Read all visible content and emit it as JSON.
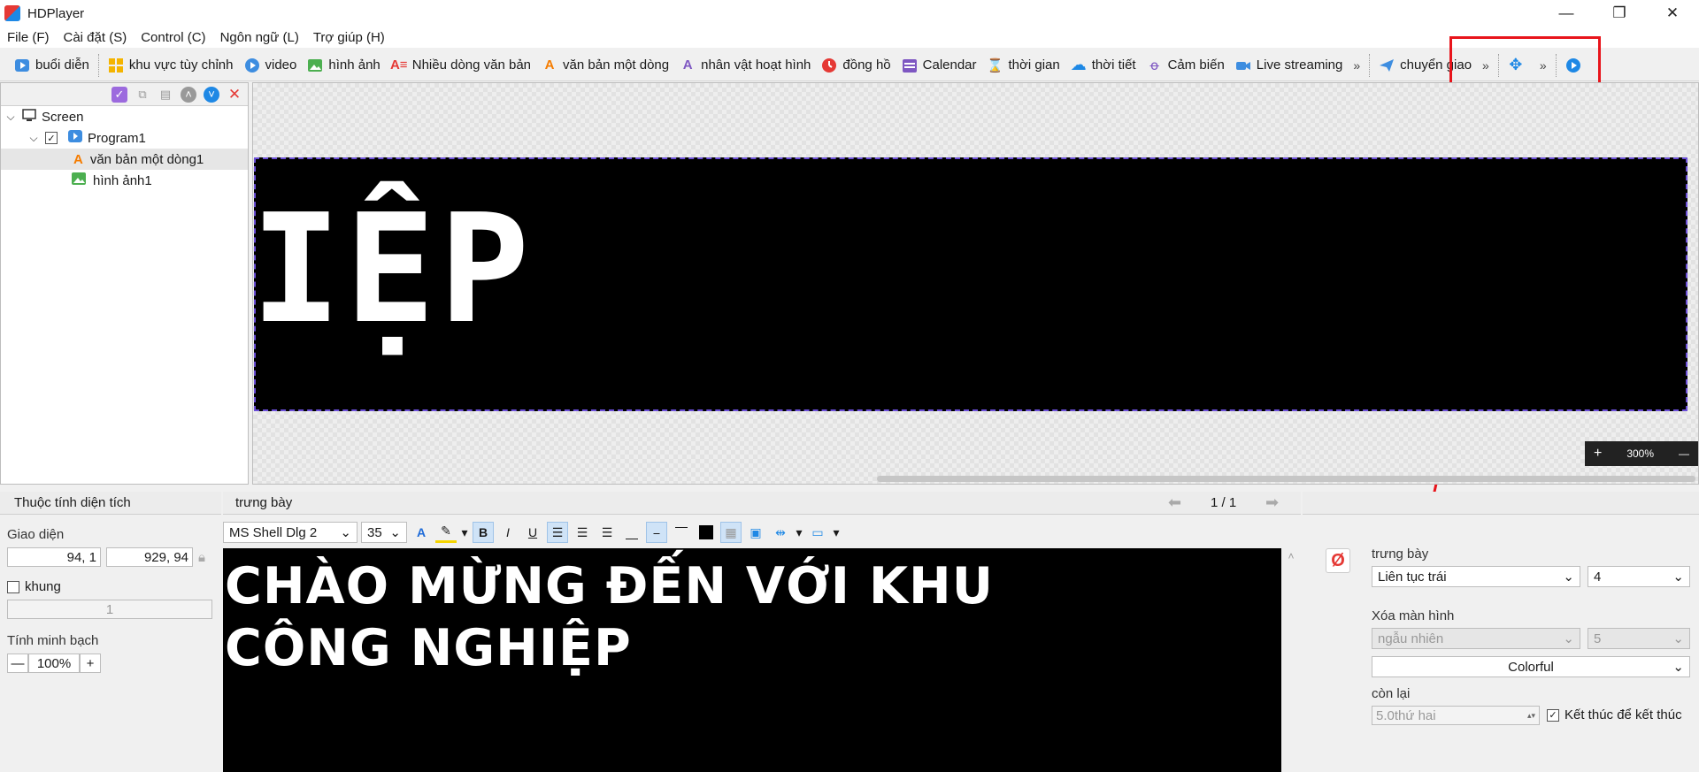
{
  "window": {
    "title": "HDPlayer",
    "controls": [
      "—",
      "❐",
      "✕"
    ]
  },
  "menu": [
    "File (F)",
    "Cài đặt (S)",
    "Control (C)",
    "Ngôn ngữ (L)",
    "Trợ giúp (H)"
  ],
  "toolbar": {
    "program": "buổi diễn",
    "custom_area": "khu vực tùy chỉnh",
    "video": "video",
    "image": "hình ảnh",
    "multiline_text": "Nhiều dòng văn bản",
    "single_line_text": "văn bản một dòng",
    "animated_character": "nhân vật hoạt hình",
    "clock": "đồng hồ",
    "calendar": "Calendar",
    "time": "thời gian",
    "weather": "thời tiết",
    "sensor": "Cảm biến",
    "live_streaming": "Live streaming",
    "more1": "»",
    "transfer": "chuyển giao",
    "more2": "»",
    "more3": "»"
  },
  "tree": {
    "root": "Screen",
    "program": "Program1",
    "item_text": "văn bản một dòng1",
    "item_image": "hình ảnh1"
  },
  "canvas": {
    "led_text": "NIỆP",
    "zoom_plus": "+",
    "zoom_level": "300%",
    "zoom_minus": "—"
  },
  "area_props": {
    "header": "Thuộc tính diện tích",
    "section_interface": "Giao diện",
    "position": "94, 1",
    "size": "929, 94",
    "frame_label": "khung",
    "frame_value": "1",
    "transparency_label": "Tính minh bạch",
    "transparency_minus": "—",
    "transparency_value": "100%",
    "transparency_plus": "+"
  },
  "display_panel": {
    "header": "trưng bày",
    "page": "1 / 1",
    "font": "MS Shell Dlg 2",
    "font_size": "35",
    "bold": "B",
    "italic": "I",
    "underline": "U",
    "content_line1": "CHÀO MỪNG ĐẾN VỚI KHU",
    "content_line2": "CÔNG NGHIỆP"
  },
  "effects": {
    "display_label": "trưng bày",
    "display_value": "Liên tục trái",
    "display_speed": "4",
    "clear_label": "Xóa màn hình",
    "clear_value": "ngẫu nhiên",
    "clear_speed": "5",
    "color_mode": "Colorful",
    "remaining_label": "còn lại",
    "remaining_value": "5.0thứ hai",
    "end_label": "Kết thúc để kết thúc"
  },
  "colors": {
    "annotation": "#e8141b",
    "led_bg": "#000000",
    "led_fg": "#ffffff"
  }
}
